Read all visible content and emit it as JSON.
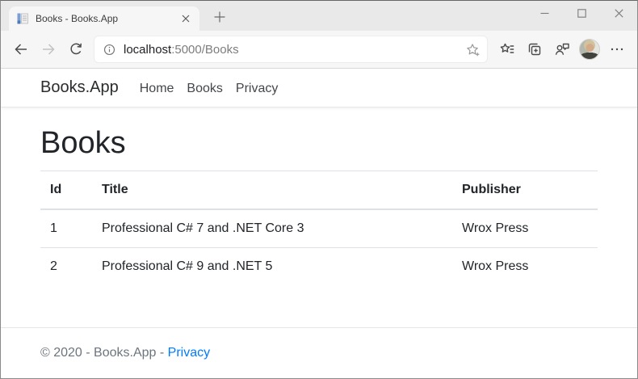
{
  "browser": {
    "tab": {
      "title": "Books - Books.App"
    },
    "address": {
      "host": "localhost",
      "path": ":5000/Books"
    },
    "icons": {
      "favicon": "book-document",
      "tab_close": "x",
      "new_tab": "+",
      "minimize": "—",
      "maximize": "□",
      "window_close": "×",
      "back": "←",
      "forward": "→",
      "refresh": "↻",
      "site_info": "ⓘ",
      "add_favorite": "star-plus",
      "favorites": "star-list",
      "collections": "stacked-squares-plus",
      "feedback": "person-chat-bubble",
      "profile": "avatar-photo",
      "more": "⋯"
    }
  },
  "page": {
    "navbar": {
      "brand": "Books.App",
      "links": [
        {
          "label": "Home"
        },
        {
          "label": "Books"
        },
        {
          "label": "Privacy"
        }
      ]
    },
    "heading": "Books",
    "table": {
      "headers": [
        "Id",
        "Title",
        "Publisher"
      ],
      "rows": [
        [
          "1",
          "Professional C# 7 and .NET Core 3",
          "Wrox Press"
        ],
        [
          "2",
          "Professional C# 9 and .NET 5",
          "Wrox Press"
        ]
      ]
    },
    "footer": {
      "copyright": "© 2020 - Books.App - ",
      "privacy_link": "Privacy"
    }
  },
  "colors": {
    "tabbar_bg": "#e9e9e9",
    "toolbar_bg": "#f6f6f6",
    "table_border": "#dee2e6",
    "footer_text": "#6c757d",
    "link_blue": "#007bff",
    "url_secondary": "#7d7d7d"
  }
}
